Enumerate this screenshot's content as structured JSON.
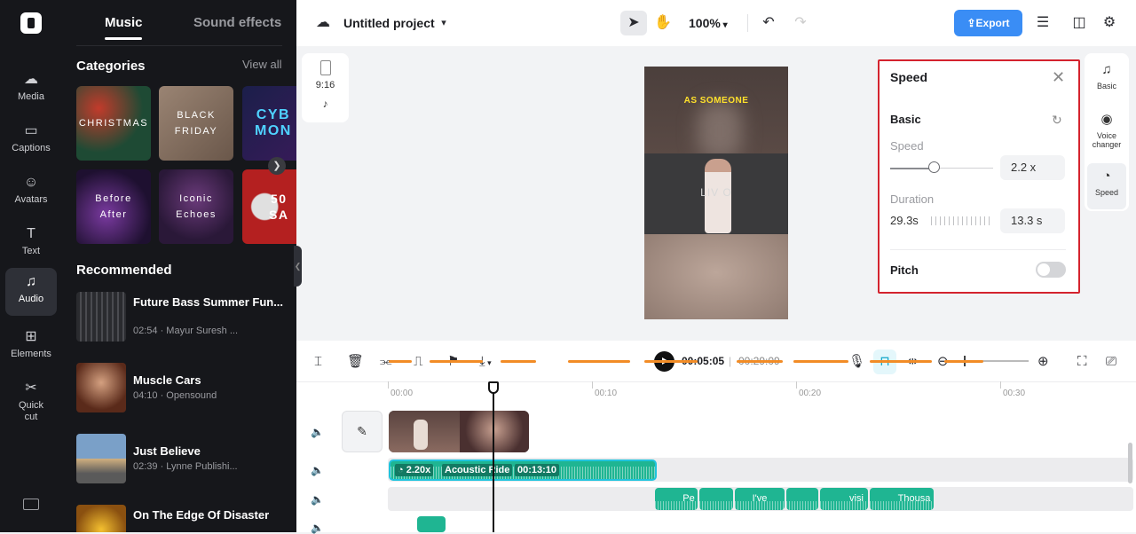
{
  "rail": {
    "items": [
      {
        "label": "Media",
        "icon": "cloud-icon"
      },
      {
        "label": "Captions",
        "icon": "captions-icon"
      },
      {
        "label": "Avatars",
        "icon": "avatar-icon"
      },
      {
        "label": "Text",
        "icon": "text-icon"
      },
      {
        "label": "Audio",
        "icon": "music-note-icon"
      },
      {
        "label": "Elements",
        "icon": "elements-icon"
      },
      {
        "label": "Quick cut",
        "icon": "scissors-icon"
      }
    ],
    "active": "Audio"
  },
  "panel": {
    "tabs": [
      "Music",
      "Sound effects"
    ],
    "active_tab": "Music",
    "categories_title": "Categories",
    "view_all": "View all",
    "categories": [
      {
        "label": "CHRISTMAS",
        "color": "#1e4a34"
      },
      {
        "label": "BLACK\nFRIDAY",
        "color": "#7a6656"
      },
      {
        "label": "CYB\nMON",
        "color": "#1b1f4a"
      },
      {
        "label": "Before\nAfter",
        "color": "#3a1d52"
      },
      {
        "label": "Iconic\nEchoes",
        "color": "#3b2248"
      },
      {
        "label": "50\nSA",
        "color": "#9a2020"
      }
    ],
    "recommended_title": "Recommended",
    "tracks": [
      {
        "title": "Future Bass Summer Fun...",
        "sub": "02:54 · Mayur Suresh ...",
        "color": "#3a3b3f"
      },
      {
        "title": "Muscle Cars",
        "sub": "04:10 · Opensound",
        "color": "#6a3a2a"
      },
      {
        "title": "Just Believe",
        "sub": "02:39 · Lynne Publishi...",
        "color": "#5a7a9a"
      },
      {
        "title": "On The Edge Of Disaster",
        "sub": "",
        "color": "#d4a020"
      }
    ]
  },
  "topbar": {
    "project_name": "Untitled project",
    "zoom": "100%",
    "export_label": "Export"
  },
  "canvas": {
    "ratio_label": "9:16",
    "caption_text": "AS SOMEONE",
    "mid_text": "LIV O"
  },
  "speed_panel": {
    "title": "Speed",
    "section": "Basic",
    "speed_label": "Speed",
    "speed_value": "2.2 x",
    "speed_fraction": 0.42,
    "duration_label": "Duration",
    "duration_original": "29.3s",
    "duration_value": "13.3 s",
    "pitch_label": "Pitch",
    "pitch_on": false
  },
  "right_tools": [
    {
      "label": "Basic",
      "icon": "music-note-icon"
    },
    {
      "label": "Voice changer",
      "icon": "voice-changer-icon"
    },
    {
      "label": "Speed",
      "icon": "speed-icon"
    }
  ],
  "timeline": {
    "current_time": "00:05:05",
    "total_time": "00:29:09",
    "ruler": [
      "00:00",
      "00:10",
      "00:20",
      "00:30"
    ],
    "audio_clip": {
      "speed": "2.20x",
      "name": "Acoustic Ride",
      "duration": "00:13:10"
    },
    "text_clips": [
      "Pe",
      "I've",
      "visi",
      "Thousa"
    ]
  }
}
